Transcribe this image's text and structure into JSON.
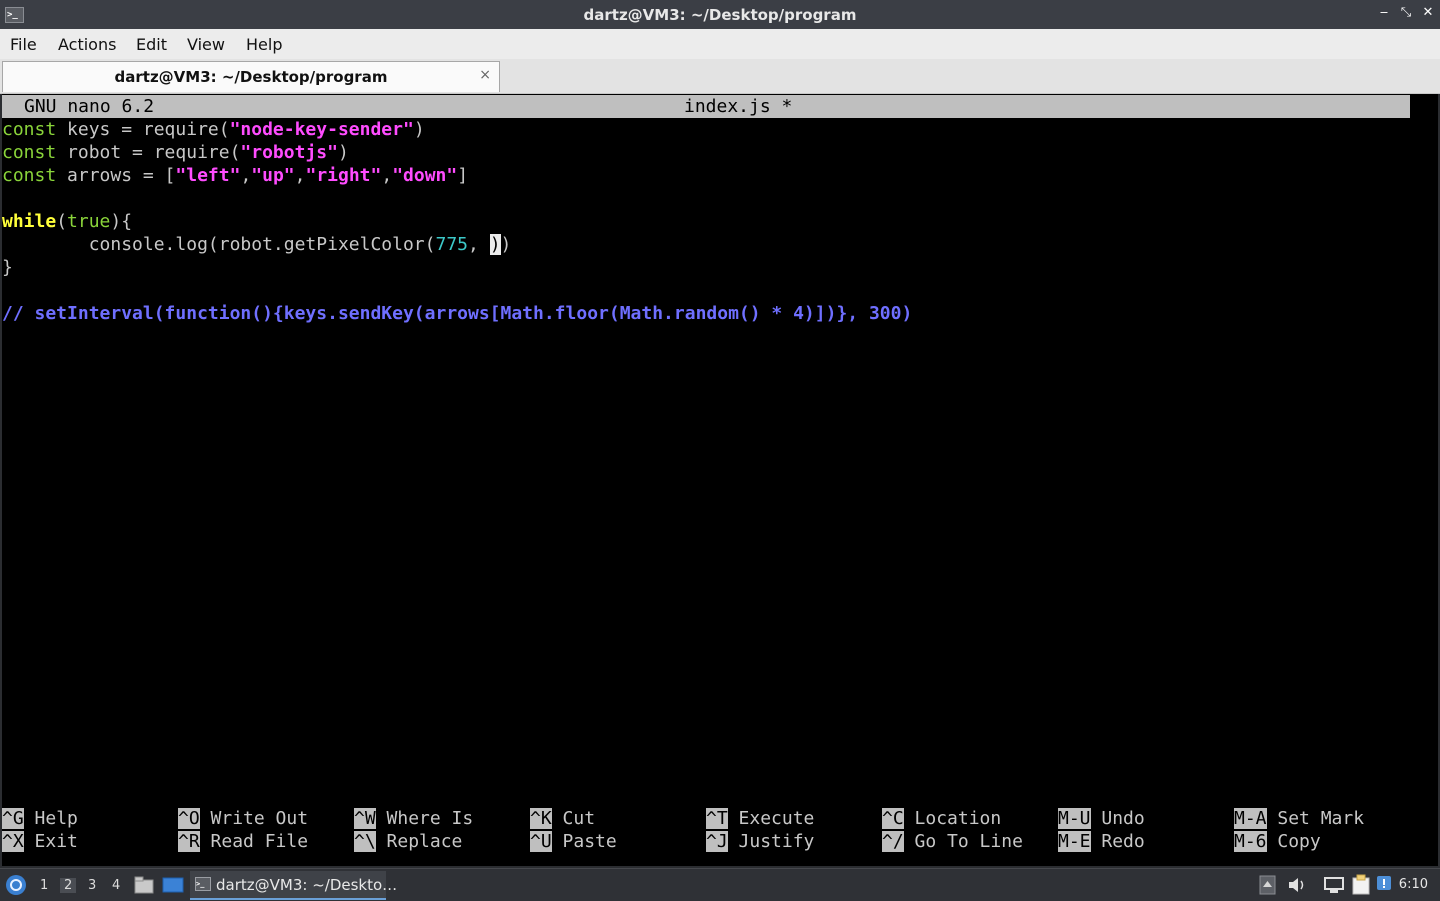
{
  "window": {
    "title": "dartz@VM3: ~/Desktop/program",
    "minimize": "‒",
    "restore": "⤡",
    "close": "✕"
  },
  "menu": {
    "file": "File",
    "actions": "Actions",
    "edit": "Edit",
    "view": "View",
    "help": "Help"
  },
  "tab": {
    "label": "dartz@VM3: ~/Desktop/program",
    "close": "×"
  },
  "nano": {
    "version": "GNU nano 6.2",
    "filename": "index.js *",
    "code": {
      "l1": {
        "kw": "const",
        "mid": " keys = require(",
        "str": "\"node-key-sender\"",
        "end": ")"
      },
      "l2": {
        "kw": "const",
        "mid": " robot = require(",
        "str": "\"robotjs\"",
        "end": ")"
      },
      "l3": {
        "kw": "const",
        "mid": " arrows = [",
        "s1": "\"left\"",
        "c1": ",",
        "s2": "\"up\"",
        "c2": ",",
        "s3": "\"right\"",
        "c3": ",",
        "s4": "\"down\"",
        "end": "]"
      },
      "l5": {
        "kw": "while",
        "p1": "(",
        "kw2": "true",
        "end": "){"
      },
      "l6": {
        "pre": "        console.log(robot.getPixelColor(",
        "num": "775",
        "mid": ", ",
        "cursor": ")",
        "end": ")"
      },
      "l7": {
        "text": "}"
      },
      "l9": {
        "text": "// setInterval(function(){keys.sendKey(arrows[Math.floor(Math.random() * 4)])}, 300)"
      }
    },
    "shortcuts": [
      {
        "k1": "^G",
        "l1": "Help",
        "k2": "^X",
        "l2": "Exit"
      },
      {
        "k1": "^O",
        "l1": "Write Out",
        "k2": "^R",
        "l2": "Read File"
      },
      {
        "k1": "^W",
        "l1": "Where Is",
        "k2": "^\\",
        "l2": "Replace"
      },
      {
        "k1": "^K",
        "l1": "Cut",
        "k2": "^U",
        "l2": "Paste"
      },
      {
        "k1": "^T",
        "l1": "Execute",
        "k2": "^J",
        "l2": "Justify"
      },
      {
        "k1": "^C",
        "l1": "Location",
        "k2": "^/",
        "l2": "Go To Line"
      },
      {
        "k1": "M-U",
        "l1": "Undo",
        "k2": "M-E",
        "l2": "Redo"
      },
      {
        "k1": "M-A",
        "l1": "Set Mark",
        "k2": "M-6",
        "l2": "Copy"
      }
    ]
  },
  "taskbar": {
    "workspaces": [
      "1",
      "2",
      "3",
      "4"
    ],
    "active_workspace": "2",
    "task_label": "dartz@VM3: ~/Deskto…",
    "clock": "6:10"
  }
}
